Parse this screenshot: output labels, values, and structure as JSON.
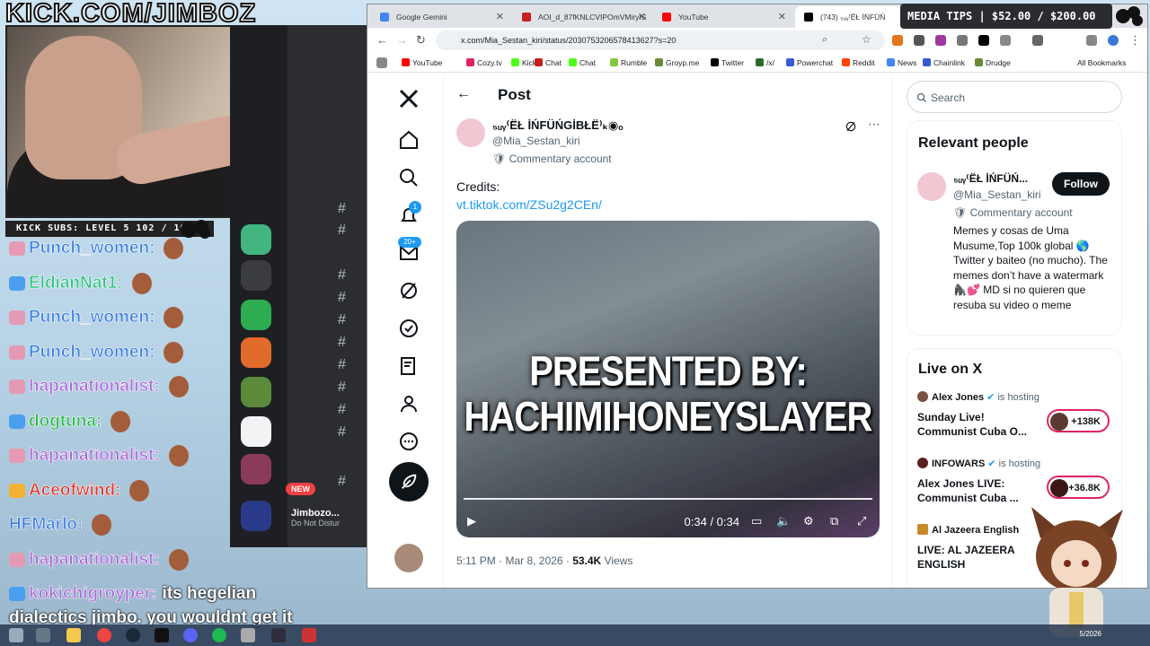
{
  "overlay": {
    "url_banner": "KICK.COM/JIMBOZ",
    "sub_bar": "KICK SUBS: LEVEL 5 102 / 100",
    "media_tips": "MEDIA TIPS | $52.00 / $200.00",
    "taskbar_date": "5/2026"
  },
  "chat": [
    {
      "user": "Punch_women:",
      "color": "#3a7de0",
      "badge": "#e59ab3",
      "msg": ""
    },
    {
      "user": "EldianNat1:",
      "color": "#2ec27e",
      "badge": "#4a9ff0",
      "msg": ""
    },
    {
      "user": "Punch_women:",
      "color": "#3a7de0",
      "badge": "#e59ab3",
      "msg": ""
    },
    {
      "user": "Punch_women:",
      "color": "#3a7de0",
      "badge": "#e59ab3",
      "msg": ""
    },
    {
      "user": "hapanationalist:",
      "color": "#a868d6",
      "badge": "#e59ab3",
      "msg": ""
    },
    {
      "user": "dogtuna:",
      "color": "#28b84a",
      "badge": "#4a9ff0",
      "msg": ""
    },
    {
      "user": "hapanationalist:",
      "color": "#a868d6",
      "badge": "#e59ab3",
      "msg": ""
    },
    {
      "user": "Aceofwind:",
      "color": "#e0342a",
      "badge": "#f2b233",
      "msg": ""
    },
    {
      "user": "HFMarlo:",
      "color": "#3a7de0",
      "badge": "",
      "msg": ""
    },
    {
      "user": "hapanationalist:",
      "color": "#a868d6",
      "badge": "#e59ab3",
      "msg": ""
    },
    {
      "user": "kokichigroyper:",
      "color": "#a868d6",
      "badge": "#4a9ff0",
      "msg": "its hegelian"
    },
    {
      "user": "",
      "color": "#ffffff",
      "badge": "",
      "msg": "dialectics jimbo. you wouldnt get it"
    }
  ],
  "discord": {
    "user_name": "Jimbozo...",
    "user_status": "Do Not Distur",
    "new_badge": "NEW"
  },
  "browser": {
    "tabs": [
      {
        "label": "Google Gemini",
        "color": "#4285f4"
      },
      {
        "label": "AOI_d_87fKNLCVIPOmVMiryIS",
        "color": "#c5221f"
      },
      {
        "label": "YouTube",
        "color": "#ff0000"
      },
      {
        "label": "(743) ₅ᵤᵧ⁽ËŁ İŃFÜŃ",
        "color": "#000000"
      }
    ],
    "url": "x.com/Mia_Sestan_kiri/status/2030753206578413627?s=20",
    "bookmarks": [
      {
        "label": "YouTube",
        "color": "#ff0000"
      },
      {
        "label": "Cozy.tv",
        "color": "#e0245e"
      },
      {
        "label": "Kick",
        "color": "#53fc18"
      },
      {
        "label": "Chat",
        "color": "#c5221f"
      },
      {
        "label": "Chat",
        "color": "#53fc18"
      },
      {
        "label": "Rumble",
        "color": "#85c742"
      },
      {
        "label": "Groyp.me",
        "color": "#6a8a3a"
      },
      {
        "label": "Twitter",
        "color": "#000000"
      },
      {
        "label": "/x/",
        "color": "#2a6a2a"
      },
      {
        "label": "Powerchat",
        "color": "#3a5ad6"
      },
      {
        "label": "Reddit",
        "color": "#ff4500"
      },
      {
        "label": "News",
        "color": "#4285f4"
      },
      {
        "label": "Chainlink",
        "color": "#375bd2"
      },
      {
        "label": "Drudge",
        "color": "#6a8a3a"
      }
    ],
    "all_bookmarks": "All Bookmarks"
  },
  "post": {
    "header": "Post",
    "author_name": "₅ᵤᵧ⁽ËŁ İŃFÜŃGİBŁË⁾ₖ◉ₒ",
    "author_handle": "@Mia_Sestan_kiri",
    "author_label": "Commentary account",
    "text": "Credits:",
    "link": "vt.tiktok.com/ZSu2g2CEn/",
    "video_caption_line1": "PRESENTED BY:",
    "video_caption_line2": "HACHIMIHONEYSLAYER",
    "video_time": "0:34 / 0:34",
    "meta_time": "5:11 PM · Mar 8, 2026 ·",
    "views_count": "53.4K",
    "views_label": "Views",
    "notification_count": "1",
    "messages_count": "20+"
  },
  "sidebar": {
    "search_placeholder": "Search",
    "relevant_title": "Relevant people",
    "rp_name": "₅ᵤᵧ⁽ËŁ İŃFÜŃ...",
    "rp_handle": "@Mia_Sestan_kiri",
    "rp_label": "Commentary account",
    "rp_bio": "Memes y cosas de Uma Musume,Top 100k global 🌎 Twitter y baiteo (no mucho). The memes don’t have a watermark 🦍💕 MD si no quieren que resuba su video o meme",
    "follow_label": "Follow",
    "live_title": "Live on X",
    "live": [
      {
        "host": "Alex Jones",
        "hosting": "is hosting",
        "title": "Sunday Live! Communist Cuba O...",
        "count": "+138K"
      },
      {
        "host": "INFOWARS",
        "hosting": "is hosting",
        "title": "Alex Jones LIVE: Communist Cuba ...",
        "count": "+36.8K"
      },
      {
        "host": "Al Jazeera English",
        "hosting": "",
        "title": "LIVE: AL JAZEERA ENGLISH",
        "count": ""
      }
    ]
  }
}
